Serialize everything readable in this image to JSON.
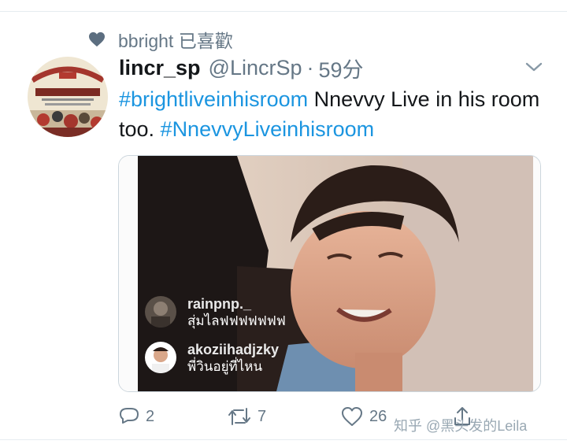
{
  "liked_by": {
    "text": "bbright 已喜歡"
  },
  "tweet": {
    "display_name": "lincr_sp",
    "handle": "@LincrSp",
    "separator": "·",
    "time": "59分",
    "text_parts": [
      {
        "text": "#brightliveinhisroom",
        "type": "hashtag"
      },
      {
        "text": "  Nnevvy Live in his room too. ",
        "type": "plain"
      },
      {
        "text": "#NnevvyLiveinhisroom",
        "type": "hashtag"
      }
    ]
  },
  "media": {
    "comments": [
      {
        "user": "rainpnp._",
        "message": "สุ่มไลฟฟฟฟฟฟฟ"
      },
      {
        "user": "akoziihadjzky",
        "message": "พี่วินอยู่ที่ไหน"
      }
    ]
  },
  "actions": {
    "reply_count": "2",
    "retweet_count": "7",
    "like_count": "26"
  },
  "watermark": {
    "text": "知乎 @黑头发的Leila"
  },
  "colors": {
    "hashtag": "#1b95e0",
    "secondary": "#657786",
    "icon": "#657786",
    "heart": "#5c6e80"
  },
  "icons": [
    "heart-icon",
    "chevron-down-icon",
    "reply-icon",
    "retweet-icon",
    "like-icon",
    "share-icon"
  ]
}
